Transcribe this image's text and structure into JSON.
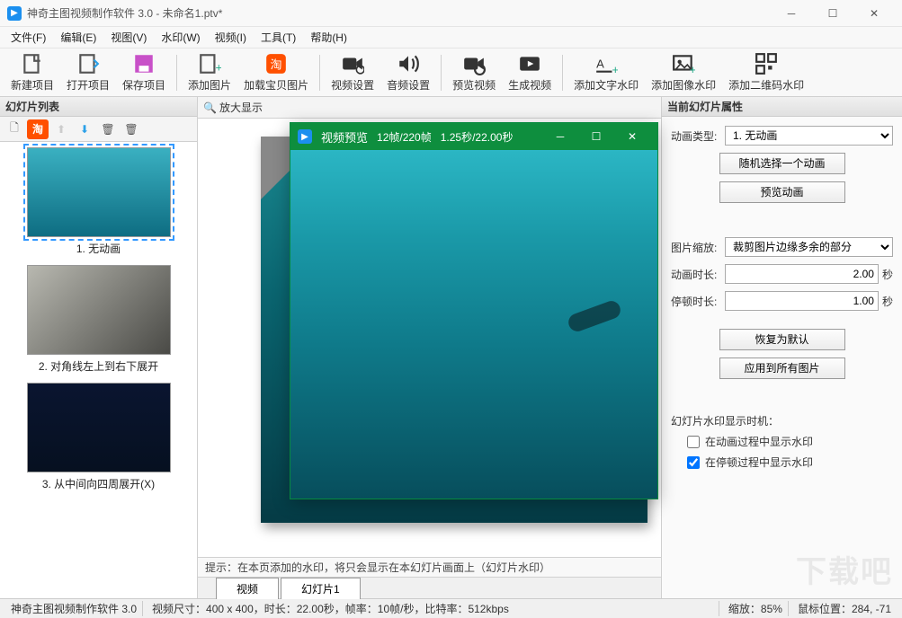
{
  "title": "神奇主图视频制作软件 3.0  - 未命名1.ptv*",
  "menu": [
    "文件(F)",
    "编辑(E)",
    "视图(V)",
    "水印(W)",
    "视频(I)",
    "工具(T)",
    "帮助(H)"
  ],
  "toolbar": [
    {
      "id": "new-project",
      "label": "新建项目"
    },
    {
      "id": "open-project",
      "label": "打开项目"
    },
    {
      "id": "save-project",
      "label": "保存项目"
    },
    {
      "sep": true
    },
    {
      "id": "add-image",
      "label": "添加图片"
    },
    {
      "id": "load-taobao",
      "label": "加载宝贝图片"
    },
    {
      "sep": true
    },
    {
      "id": "video-settings",
      "label": "视频设置"
    },
    {
      "id": "audio-settings",
      "label": "音频设置"
    },
    {
      "sep": true
    },
    {
      "id": "preview-video",
      "label": "预览视频"
    },
    {
      "id": "build-video",
      "label": "生成视频"
    },
    {
      "sep": true
    },
    {
      "id": "add-text-wm",
      "label": "添加文字水印"
    },
    {
      "id": "add-image-wm",
      "label": "添加图像水印"
    },
    {
      "id": "add-qr-wm",
      "label": "添加二维码水印"
    }
  ],
  "left": {
    "header": "幻灯片列表",
    "slides": [
      {
        "caption": "1. 无动画",
        "bg": "linear-gradient(180deg,#3ab0c1,#0e6d82)"
      },
      {
        "caption": "2. 对角线左上到右下展开",
        "bg": "linear-gradient(135deg,#b8b8b0,#4a4a46)"
      },
      {
        "caption": "3. 从中间向四周展开(X)",
        "bg": "linear-gradient(180deg,#0a1530,#061020)"
      }
    ]
  },
  "center": {
    "zoom_in": "放大显示",
    "hint": "提示：在本页添加的水印，将只会显示在本幻灯片画面上（幻灯片水印）",
    "tabs": [
      "视频",
      "幻灯片1"
    ]
  },
  "preview": {
    "title": "视频预览",
    "frames": "12帧/220帧",
    "time": "1.25秒/22.00秒"
  },
  "right": {
    "header": "当前幻灯片属性",
    "anim_type_label": "动画类型:",
    "anim_type_value": "1. 无动画",
    "btn_random": "随机选择一个动画",
    "btn_preview": "预览动画",
    "scale_label": "图片缩放:",
    "scale_value": "裁剪图片边缘多余的部分",
    "anim_dur_label": "动画时长:",
    "anim_dur_value": "2.00",
    "pause_dur_label": "停顿时长:",
    "pause_dur_value": "1.00",
    "unit": "秒",
    "btn_reset": "恢复为默认",
    "btn_apply": "应用到所有图片",
    "wm_header": "幻灯片水印显示时机：",
    "wm_chk1": "在动画过程中显示水印",
    "wm_chk2": "在停顿过程中显示水印"
  },
  "status": {
    "app": "神奇主图视频制作软件 3.0",
    "size": "视频尺寸：400 x 400，时长：22.00秒，帧率：10帧/秒，比特率：512kbps",
    "zoom": "缩放：85%",
    "mouse": "鼠标位置：284, -71"
  },
  "watermark": "下载吧"
}
